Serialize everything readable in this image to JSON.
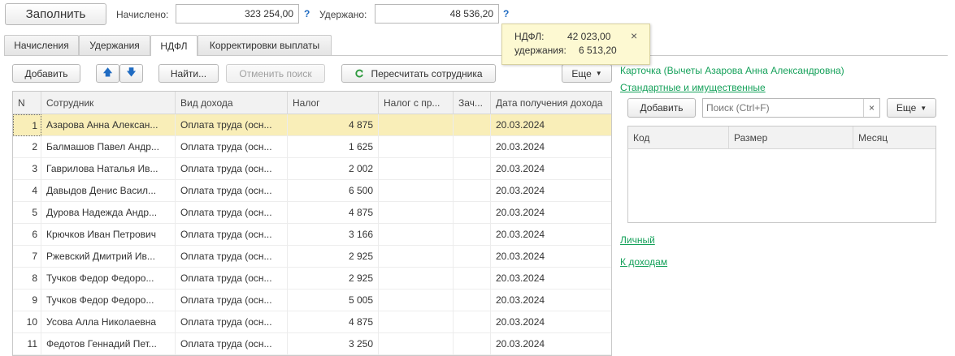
{
  "toolbar": {
    "fill_label": "Заполнить",
    "accrued_label": "Начислено:",
    "accrued_value": "323 254,00",
    "withheld_label": "Удержано:",
    "withheld_value": "48 536,20",
    "help_glyph": "?"
  },
  "tabs": [
    "Начисления",
    "Удержания",
    "НДФЛ",
    "Корректировки выплаты"
  ],
  "grid_toolbar": {
    "add_label": "Добавить",
    "up_glyph": "🡅",
    "down_glyph": "🡇",
    "find_label": "Найти...",
    "cancel_search_label": "Отменить поиск",
    "recalc_label": "Пересчитать сотрудника",
    "more_label": "Еще"
  },
  "tooltip": {
    "ndfl_label": "НДФЛ:",
    "ndfl_value": "42 023,00",
    "withheld_label": "удержания:",
    "withheld_value": "6 513,20",
    "close_glyph": "×"
  },
  "table": {
    "headers": [
      "N",
      "Сотрудник",
      "Вид дохода",
      "Налог",
      "Налог с пр...",
      "Зач...",
      "Дата получения дохода"
    ],
    "rows": [
      {
        "n": "1",
        "employee": "Азарова Анна Алексан...",
        "income": "Оплата труда (осн...",
        "tax": "4 875",
        "tax_pr": "",
        "zach": "",
        "date": "20.03.2024"
      },
      {
        "n": "2",
        "employee": "Балмашов Павел Андр...",
        "income": "Оплата труда (осн...",
        "tax": "1 625",
        "tax_pr": "",
        "zach": "",
        "date": "20.03.2024"
      },
      {
        "n": "3",
        "employee": "Гаврилова Наталья Ив...",
        "income": "Оплата труда (осн...",
        "tax": "2 002",
        "tax_pr": "",
        "zach": "",
        "date": "20.03.2024"
      },
      {
        "n": "4",
        "employee": "Давыдов Денис Васил...",
        "income": "Оплата труда (осн...",
        "tax": "6 500",
        "tax_pr": "",
        "zach": "",
        "date": "20.03.2024"
      },
      {
        "n": "5",
        "employee": "Дурова Надежда Андр...",
        "income": "Оплата труда (осн...",
        "tax": "4 875",
        "tax_pr": "",
        "zach": "",
        "date": "20.03.2024"
      },
      {
        "n": "6",
        "employee": "Крючков Иван Петрович",
        "income": "Оплата труда (осн...",
        "tax": "3 166",
        "tax_pr": "",
        "zach": "",
        "date": "20.03.2024"
      },
      {
        "n": "7",
        "employee": "Ржевский Дмитрий Ив...",
        "income": "Оплата труда (осн...",
        "tax": "2 925",
        "tax_pr": "",
        "zach": "",
        "date": "20.03.2024"
      },
      {
        "n": "8",
        "employee": "Тучков Федор Федоро...",
        "income": "Оплата труда (осн...",
        "tax": "2 925",
        "tax_pr": "",
        "zach": "",
        "date": "20.03.2024"
      },
      {
        "n": "9",
        "employee": "Тучков Федор Федоро...",
        "income": "Оплата труда (осн...",
        "tax": "5 005",
        "tax_pr": "",
        "zach": "",
        "date": "20.03.2024"
      },
      {
        "n": "10",
        "employee": "Усова Алла Николаевна",
        "income": "Оплата труда (осн...",
        "tax": "4 875",
        "tax_pr": "",
        "zach": "",
        "date": "20.03.2024"
      },
      {
        "n": "11",
        "employee": "Федотов Геннадий Пет...",
        "income": "Оплата труда (осн...",
        "tax": "3 250",
        "tax_pr": "",
        "zach": "",
        "date": "20.03.2024"
      }
    ]
  },
  "right_panel": {
    "card_title": "Карточка (Вычеты Азарова Анна Александровна)",
    "std_link": "Стандартные и имущественные",
    "add_label": "Добавить",
    "search_placeholder": "Поиск (Ctrl+F)",
    "clear_glyph": "×",
    "more_label": "Еще",
    "headers": [
      "Код",
      "Размер",
      "Месяц"
    ],
    "personal_link": "Личный",
    "income_link": "К доходам"
  },
  "colors": {
    "accent_green": "#15a15a",
    "selected_row": "#f9eeb8",
    "tooltip_bg": "#fdf9d2",
    "help_blue": "#1f6bc2"
  }
}
